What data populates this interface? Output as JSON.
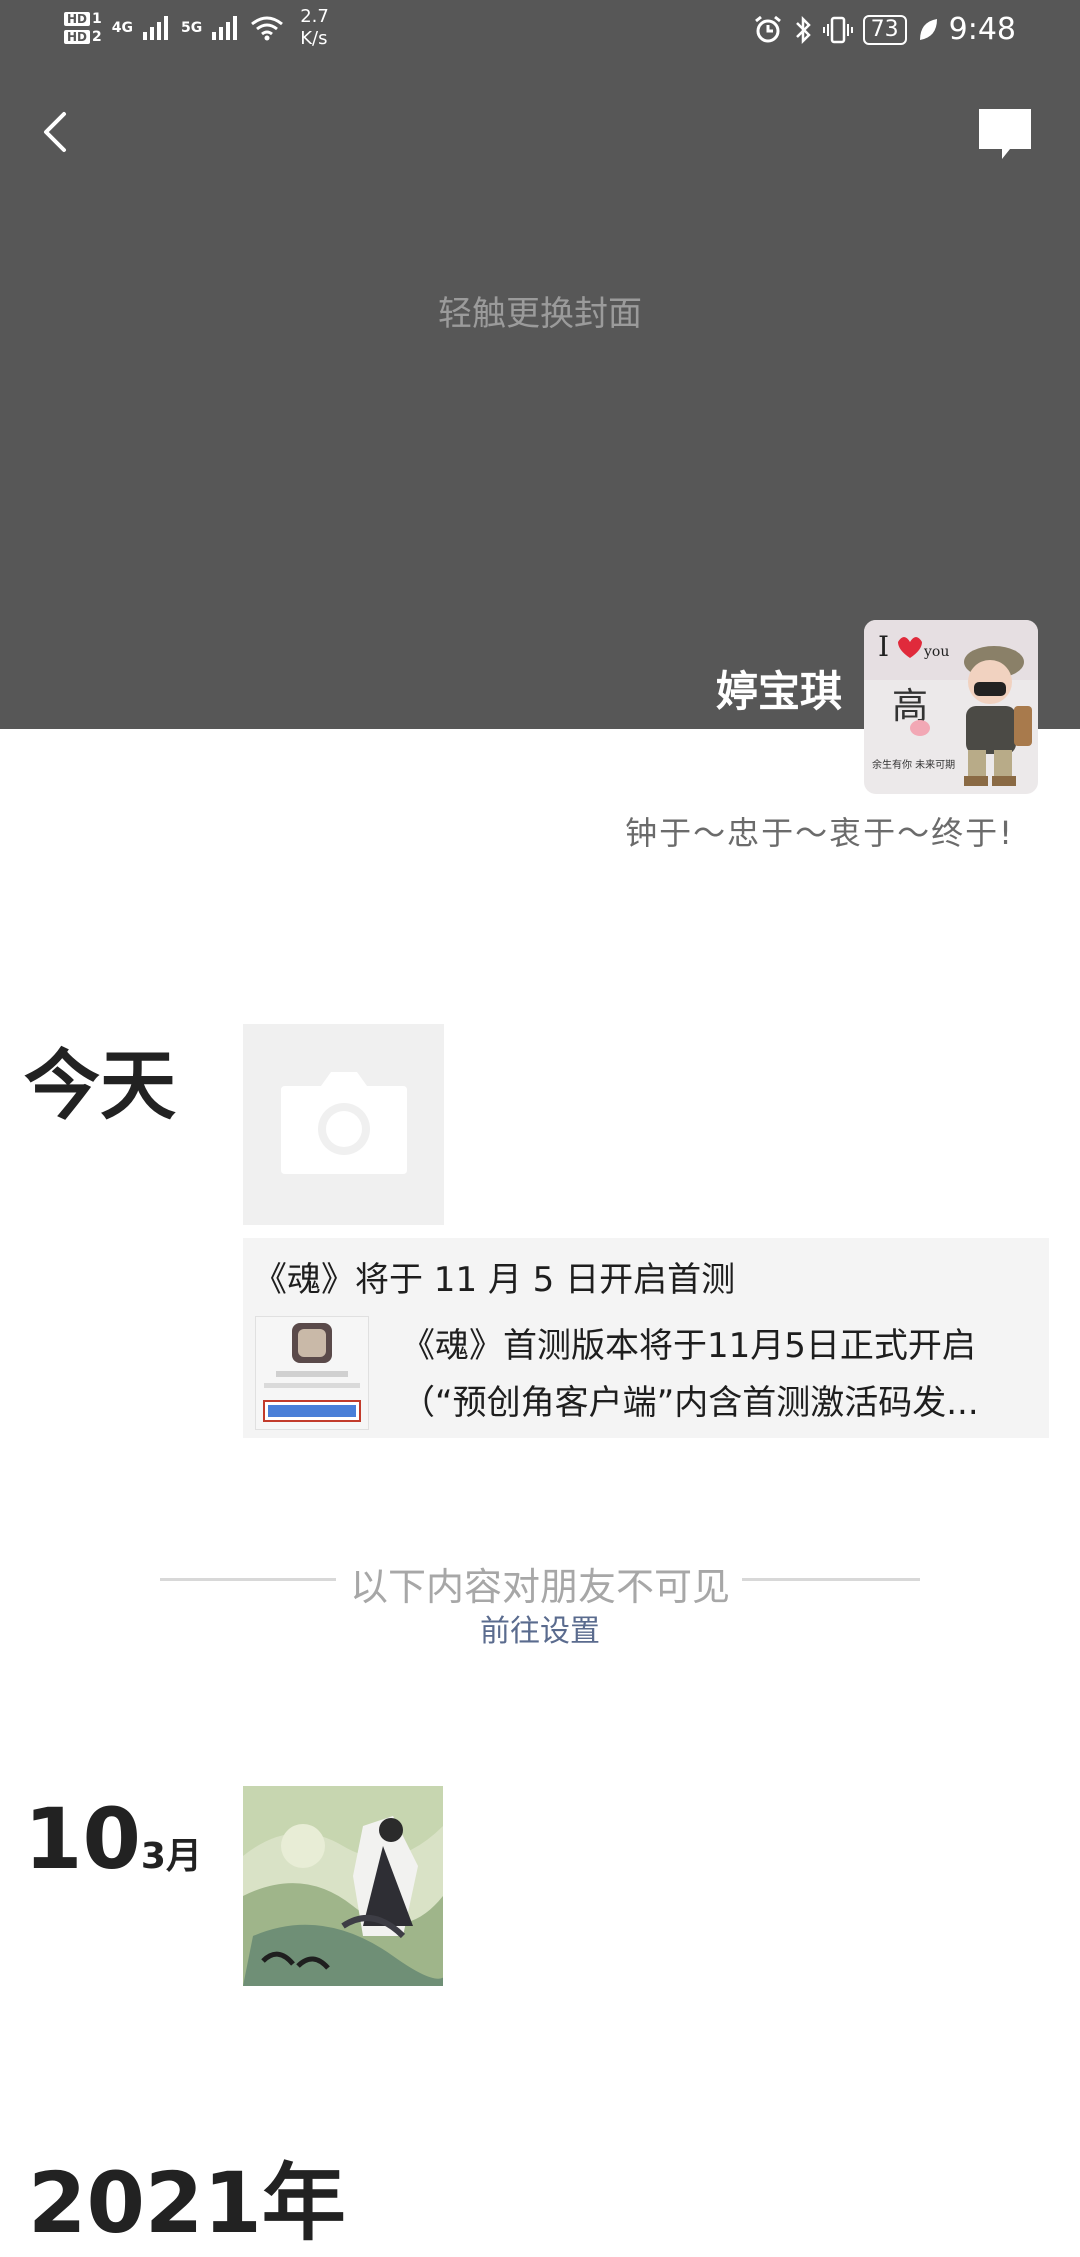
{
  "status_bar": {
    "hd1": "HD",
    "sim1": "1",
    "hd2": "HD",
    "sim2": "2",
    "net1": "4G",
    "net2": "5G",
    "speed_value": "2.7",
    "speed_unit": "K/s",
    "battery": "73",
    "time": "9:48"
  },
  "header": {
    "change_cover_hint": "轻触更换封面",
    "username": "婷宝琪",
    "signature": "钟于～忠于～衷于～终于!"
  },
  "timeline": {
    "today_label": "今天",
    "share": {
      "title": "《魂》将于 11 月 5 日开启首测",
      "desc_line1": "《魂》首测版本将于11月5日正式开启",
      "desc_line2": "（“预创角客户端”内含首测激活码发..."
    },
    "privacy_divider": "以下内容对朋友不可见",
    "goto_settings": "前往设置",
    "entry_day": "10",
    "entry_month": "3月",
    "year_label": "2021年"
  },
  "colors": {
    "cover_bg": "#575757",
    "link": "#5a6b8e",
    "card_bg": "#f4f4f4"
  }
}
